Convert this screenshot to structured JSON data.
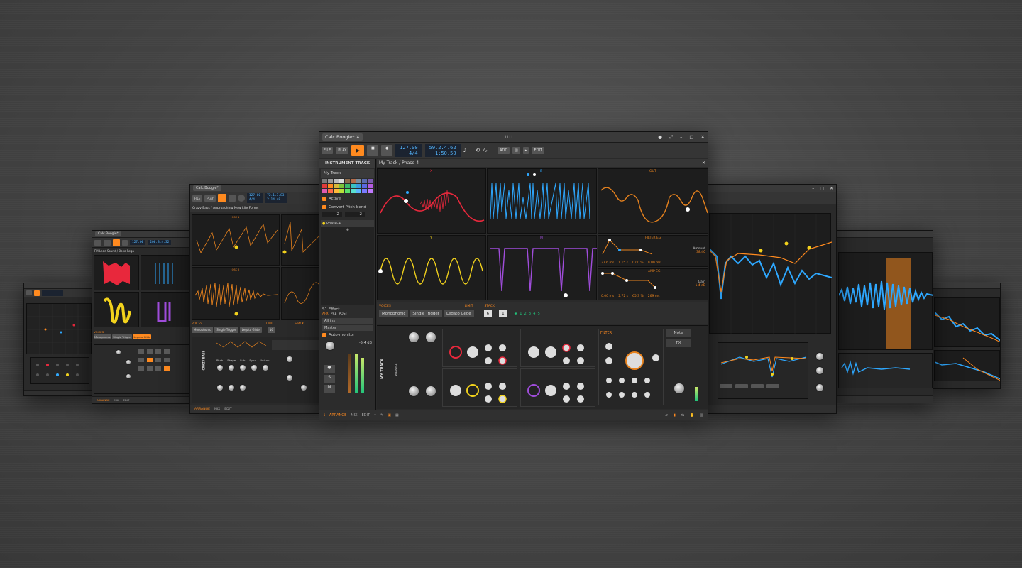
{
  "main": {
    "tab_title": "Calc Boogie*",
    "file_label": "FILE",
    "play_label": "PLAY",
    "tempo": "127.00",
    "time_sig": "4/4",
    "position": "59.2.4.62",
    "time": "1:50.50",
    "add_label": "ADD",
    "edit_label": "EDIT",
    "inspector_title": "INSTRUMENT TRACK",
    "track_name": "My Track",
    "active_label": "Active",
    "pitchbend_label": "Convert Pitch-bend",
    "pb_down": "-2",
    "pb_up": "2",
    "device_label": "Phase-4",
    "panel_title": "My Track / Phase-4",
    "scope_x": "X",
    "scope_b": "B",
    "scope_out": "OUT",
    "scope_y": "Y",
    "scope_m": "M",
    "filter_eg": "FILTER EG",
    "amp_eg": "AMP EG",
    "filter_vals": [
      "37.6 ms",
      "1.15 s",
      "0.00 %",
      "0.00 ms"
    ],
    "amount_label": "Amount",
    "amount_val": "38.40",
    "amp_vals": [
      "0.00 ms",
      "2.72 s",
      "65.3 %",
      "269 ms"
    ],
    "gain_label": "Gain",
    "gain_val": "-1.4 dB",
    "voices_label": "VOICES",
    "limit_label": "LIMIT",
    "stack_label": "STACK",
    "mono": "Monophonic",
    "single": "Single Trigger",
    "legato": "Legato Glide",
    "limit_val": "6",
    "stack_val": "1",
    "fx_label": "S1 Effect",
    "fx_tabs": [
      "AFX",
      "PRE",
      "POST"
    ],
    "io_in": "All ins",
    "io_out": "Master",
    "automon": "Auto-monitor",
    "meter_db": "-5.4 dB",
    "track_vertical": "MY TRACK",
    "note_tab": "Note",
    "fx_tab": "FX",
    "filter_label": "FILTER",
    "status": [
      "ARRANGE",
      "MIX",
      "EDIT"
    ]
  },
  "win2": {
    "tab_title": "Calc Boogie*",
    "file_label": "FILE",
    "play_label": "PLAY",
    "tempo": "127.00",
    "position": "72.1.3.83",
    "time_sig": "4/4",
    "time": "2:14.48",
    "panel_title": "Crazy Bass / Approaching New Life Forms",
    "osc1": "OSC 1",
    "osc2": "OSC 2",
    "voices": "VOICES",
    "mono": "Monophonic",
    "single": "Single Trigger",
    "legato": "Legato Glide",
    "limit": "LIMIT",
    "stack": "STACK",
    "limit_val": "16",
    "track_vertical": "CRAZY BASS",
    "osc_labels": [
      "Pitch",
      "Shape",
      "Sub",
      "Sync",
      "Unison"
    ],
    "status": [
      "ARRANGE",
      "MIX",
      "EDIT"
    ]
  },
  "win3": {
    "tab_title": "Calc Boogie*",
    "tempo": "127.00",
    "position": "200.3.4.32",
    "panel_title": "FM Lead Sound / Bona Rega",
    "voices": "VOICES",
    "mono": "Monophonic",
    "single": "Single Trigger",
    "legato": "Legato Glide",
    "status": [
      "ARRANGE",
      "MIX",
      "EDIT"
    ]
  },
  "colors": {
    "accent": "#ff8a1f",
    "scope_red": "#e8283c",
    "scope_blue": "#2ea8ff",
    "scope_yellow": "#f2d21c",
    "scope_purple": "#a04ddb",
    "scope_orange": "#e8831e"
  }
}
